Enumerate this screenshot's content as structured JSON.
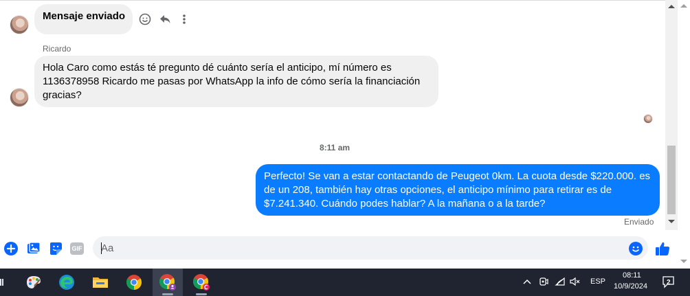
{
  "messages": [
    {
      "type": "incoming",
      "text": "Mensaje enviado"
    },
    {
      "type": "incoming",
      "sender": "Ricardo",
      "lines": [
        "Hola Caro como estás té pregunto dé cuánto sería el anticipo, mí número es",
        "1136378958 Ricardo me pasas por WhatsApp la info de cómo sería la financiación",
        "gracias?"
      ]
    },
    {
      "type": "timestamp",
      "text": "8:11 am"
    },
    {
      "type": "outgoing",
      "lines": [
        "Perfecto!  Se van a estar contactando de Peugeot 0km. La cuota desde $220.000. es",
        "de un 208, también hay otras opciones, el anticipo mínimo para retirar es de",
        "$7.241.340. Cuándo podes hablar? A la mañana o a la tarde?"
      ],
      "status": "Enviado"
    }
  ],
  "composer": {
    "placeholder": "Aa",
    "gif_label": "GIF",
    "icons": [
      "plus-icon",
      "image-icon",
      "sticker-icon",
      "gif-icon",
      "emoji-icon",
      "thumbs-up-icon"
    ]
  },
  "taskbar": {
    "apps": [
      "paint-icon",
      "edge-icon",
      "file-explorer-icon",
      "chrome-icon",
      "chrome-profile-icon",
      "chrome-profile-c-icon"
    ],
    "language": "ESP",
    "time": "08:11",
    "date": "10/9/2024",
    "notification_count": "2"
  },
  "colors": {
    "outgoing_bubble": "#0a7cff",
    "incoming_bubble": "#f0f0f0",
    "accent": "#0866ff",
    "taskbar": "#1f2430"
  }
}
